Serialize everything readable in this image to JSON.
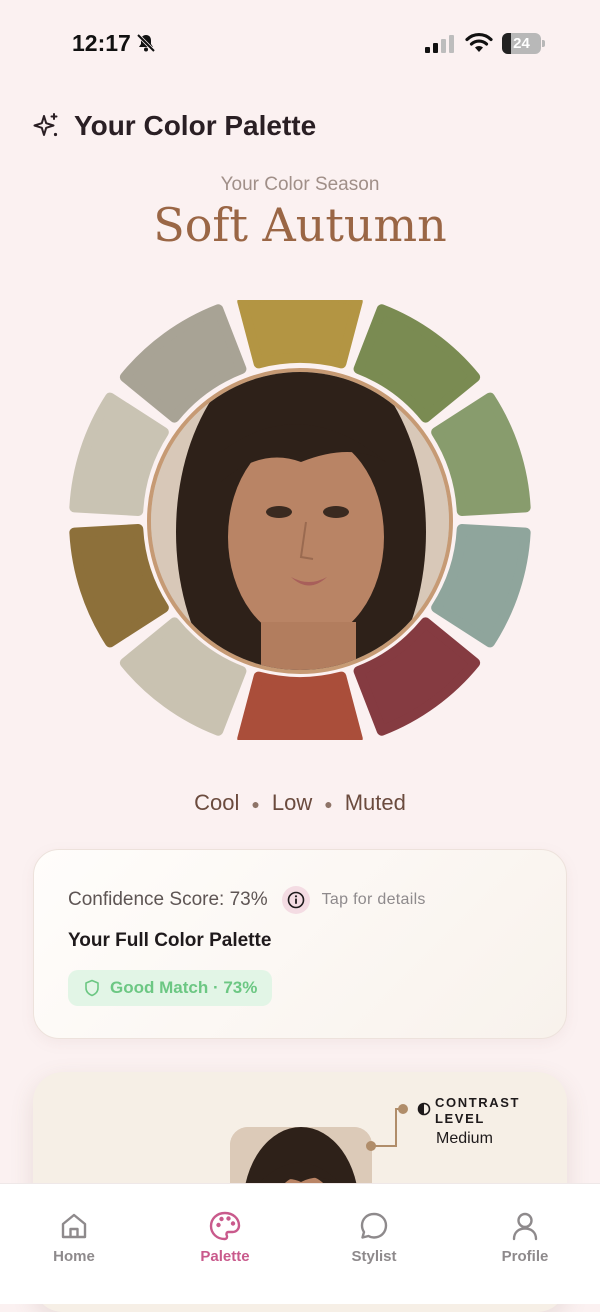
{
  "status_bar": {
    "time": "12:17",
    "battery_percent": "24",
    "battery_level": 0.24
  },
  "header": {
    "title": "Your Color Palette"
  },
  "season": {
    "label": "Your Color Season",
    "name": "Soft Autumn"
  },
  "wheel": {
    "colors": [
      "#B39543",
      "#7A8B52",
      "#889C6D",
      "#8FA59C",
      "#853B41",
      "#AA4E3A",
      "#C9C2B1",
      "#8D703A",
      "#C9C3B3",
      "#A8A395"
    ]
  },
  "traits": [
    "Cool",
    "Low",
    "Muted"
  ],
  "confidence_card": {
    "confidence_text": "Confidence Score: 73%",
    "tap_text": "Tap for details",
    "palette_title": "Your Full Color Palette",
    "match_badge": "Good Match · 73%"
  },
  "contrast_card": {
    "label": "CONTRAST LEVEL",
    "value": "Medium"
  },
  "tab_bar": {
    "tabs": [
      {
        "label": "Home"
      },
      {
        "label": "Palette"
      },
      {
        "label": "Stylist"
      },
      {
        "label": "Profile"
      }
    ],
    "active": "Palette"
  },
  "theme": {
    "accent": "#C95A8C",
    "background": "#FBF1F1",
    "season_color": "#9A6645",
    "match_green": "#6CC783"
  }
}
